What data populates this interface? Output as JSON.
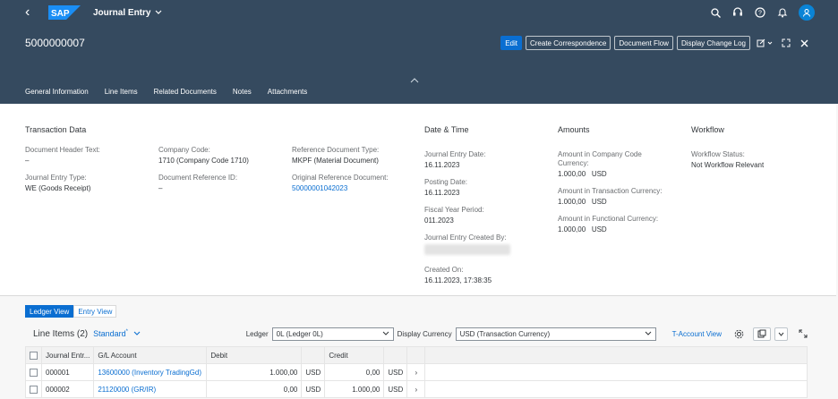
{
  "shell": {
    "logo_text": "SAP",
    "app_title": "Journal Entry"
  },
  "header": {
    "object_title": "5000000007",
    "actions": [
      "Edit",
      "Create Correspondence",
      "Document Flow",
      "Display Change Log"
    ]
  },
  "tabs": [
    "General Information",
    "Line Items",
    "Related Documents",
    "Notes",
    "Attachments"
  ],
  "general": {
    "transaction": {
      "title": "Transaction Data",
      "doc_header_text_label": "Document Header Text:",
      "doc_header_text_value": "–",
      "je_type_label": "Journal Entry Type:",
      "je_type_value": "WE (Goods Receipt)",
      "company_code_label": "Company Code:",
      "company_code_value": "1710 (Company Code 1710)",
      "doc_ref_id_label": "Document Reference ID:",
      "doc_ref_id_value": "–",
      "ref_doc_type_label": "Reference Document Type:",
      "ref_doc_type_value": "MKPF (Material Document)",
      "orig_ref_doc_label": "Original Reference Document:",
      "orig_ref_doc_value": "50000001042023"
    },
    "datetime": {
      "title": "Date & Time",
      "je_date_label": "Journal Entry Date:",
      "je_date_value": "16.11.2023",
      "posting_date_label": "Posting Date:",
      "posting_date_value": "16.11.2023",
      "fy_period_label": "Fiscal Year Period:",
      "fy_period_value": "011.2023",
      "created_by_label": "Journal Entry Created By:",
      "created_on_label": "Created On:",
      "created_on_value": "16.11.2023, 17:38:35"
    },
    "amounts": {
      "title": "Amounts",
      "cc_currency_label": "Amount in Company Code Currency:",
      "cc_currency_value": "1.000,00",
      "cc_currency_unit": "USD",
      "tx_currency_label": "Amount in Transaction Currency:",
      "tx_currency_value": "1.000,00",
      "tx_currency_unit": "USD",
      "fn_currency_label": "Amount in Functional Currency:",
      "fn_currency_value": "1.000,00",
      "fn_currency_unit": "USD"
    },
    "workflow": {
      "title": "Workflow",
      "status_label": "Workflow Status:",
      "status_value": "Not Workflow Relevant"
    }
  },
  "line_items": {
    "view_toggle": [
      "Ledger View",
      "Entry View"
    ],
    "title": "Line Items (2)",
    "variant": "Standard",
    "variant_marker": "*",
    "ledger_label": "Ledger",
    "ledger_value": "0L (Ledger 0L)",
    "currency_label": "Display Currency",
    "currency_value": "USD (Transaction Currency)",
    "t_account_label": "T-Account View",
    "columns": [
      "Journal Entr...",
      "G/L Account",
      "Debit",
      "",
      "Credit",
      ""
    ],
    "rows": [
      {
        "entry": "000001",
        "gl": "13600000 (Inventory TradingGd)",
        "debit": "1.000,00",
        "debit_cur": "USD",
        "credit": "0,00",
        "credit_cur": "USD"
      },
      {
        "entry": "000002",
        "gl": "21120000 (GR/IR)",
        "debit": "0,00",
        "debit_cur": "USD",
        "credit": "1.000,00",
        "credit_cur": "USD"
      }
    ]
  }
}
